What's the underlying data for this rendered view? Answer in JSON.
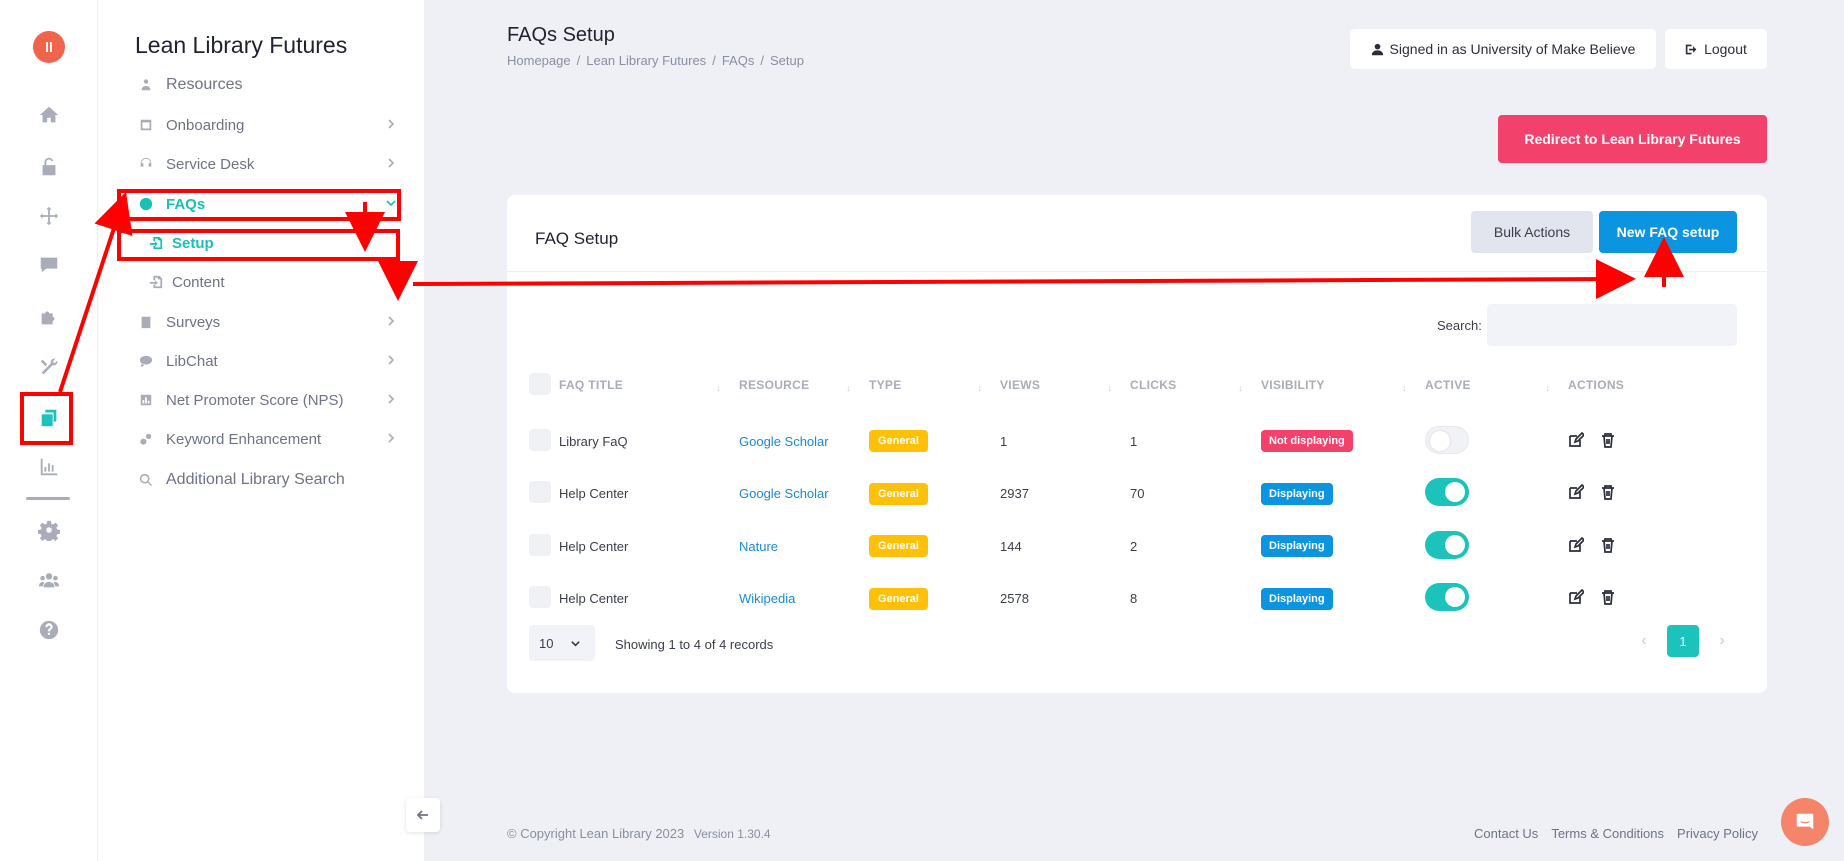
{
  "app": {
    "logo_text": "ll"
  },
  "rail": {
    "items": [
      {
        "icon": "home-icon"
      },
      {
        "icon": "lock-icon"
      },
      {
        "icon": "move-icon"
      },
      {
        "icon": "comment-icon"
      },
      {
        "icon": "puzzle-icon"
      },
      {
        "icon": "tools-icon"
      },
      {
        "icon": "copy-icon",
        "active": true
      },
      {
        "icon": "chart-icon"
      },
      {
        "icon": "gear-icon"
      },
      {
        "icon": "users-icon"
      },
      {
        "icon": "help-icon"
      }
    ]
  },
  "sidebar": {
    "title": "Lean Library Futures",
    "items": {
      "resources": "Resources",
      "onboarding": "Onboarding",
      "service_desk": "Service Desk",
      "faqs": "FAQs",
      "setup": "Setup",
      "content": "Content",
      "surveys": "Surveys",
      "libchat": "LibChat",
      "nps": "Net Promoter Score (NPS)",
      "keyword": "Keyword Enhancement",
      "additional_search": "Additional Library Search"
    }
  },
  "header": {
    "title": "FAQs Setup",
    "breadcrumb": [
      "Homepage",
      "Lean Library Futures",
      "FAQs",
      "Setup"
    ],
    "signed_in": "Signed in as University of Make Believe",
    "logout": "Logout",
    "redirect": "Redirect to Lean Library Futures"
  },
  "card": {
    "title": "FAQ Setup",
    "bulk_actions": "Bulk Actions",
    "new_faq": "New FAQ setup",
    "search_label": "Search:",
    "search_value": "",
    "columns": {
      "title": "FAQ TITLE",
      "resource": "RESOURCE",
      "type": "TYPE",
      "views": "VIEWS",
      "clicks": "CLICKS",
      "visibility": "VISIBILITY",
      "active": "ACTIVE",
      "actions": "ACTIONS"
    },
    "rows": [
      {
        "title": "Library FaQ",
        "resource": "Google Scholar",
        "type": "General",
        "views": "1",
        "clicks": "1",
        "visibility": "Not displaying"
      },
      {
        "title": "Help Center",
        "resource": "Google Scholar",
        "type": "General",
        "views": "2937",
        "clicks": "70",
        "visibility": "Displaying"
      },
      {
        "title": "Help Center",
        "resource": "Nature",
        "type": "General",
        "views": "144",
        "clicks": "2",
        "visibility": "Displaying"
      },
      {
        "title": "Help Center",
        "resource": "Wikipedia",
        "type": "General",
        "views": "2578",
        "clicks": "8",
        "visibility": "Displaying"
      }
    ],
    "page_size": "10",
    "records": "Showing 1 to 4 of 4 records",
    "current_page": "1"
  },
  "footer": {
    "copyright": "© Copyright Lean Library 2023",
    "version": "Version 1.30.4",
    "links": [
      "Contact Us",
      "Terms & Conditions",
      "Privacy Policy"
    ]
  },
  "colors": {
    "accent": "#1cc3bb",
    "primary_button": "#0b94e0",
    "redirect_button": "#f2416b",
    "badge_general": "#ffc107",
    "annotation": "#ff0000"
  }
}
